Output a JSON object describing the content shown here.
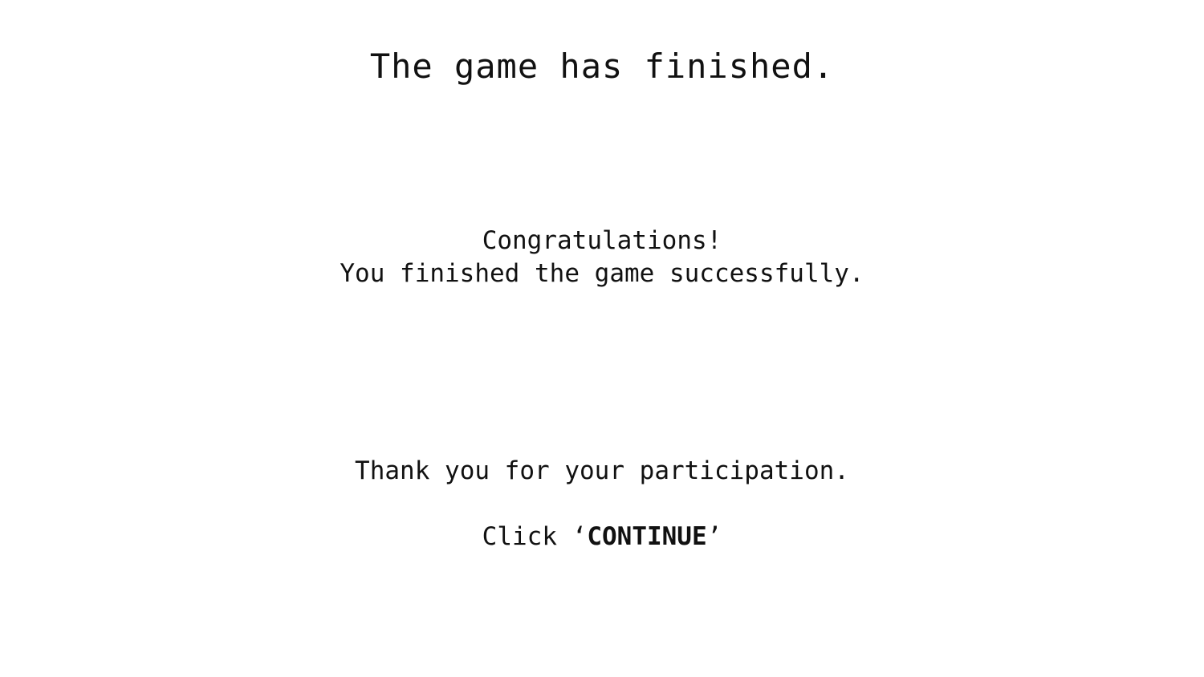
{
  "title": "The game has finished.",
  "message": {
    "congrats": "Congratulations!",
    "detail": "You finished the game successfully."
  },
  "thanks": "Thank you for your participation.",
  "instruction": {
    "prefix": "Click ‘",
    "keyword": "CONTINUE",
    "suffix": "’"
  }
}
